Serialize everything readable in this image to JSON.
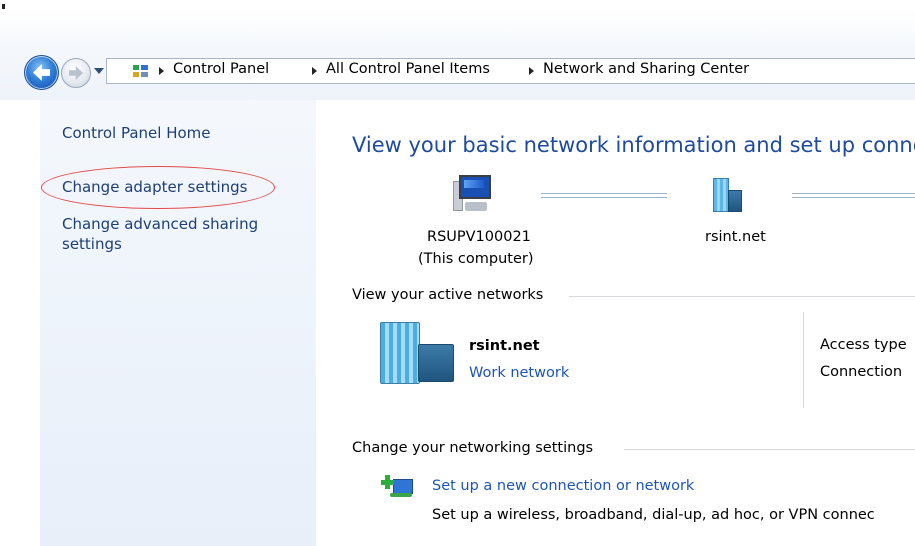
{
  "breadcrumb": [
    "Control Panel",
    "All Control Panel Items",
    "Network and Sharing Center"
  ],
  "left_nav": {
    "home": "Control Panel Home",
    "adapter": "Change adapter settings",
    "advanced_line1": "Change advanced sharing",
    "advanced_line2": "settings"
  },
  "main": {
    "title": "View your basic network information and set up conne",
    "map": {
      "computer_name": "RSUPV100021",
      "computer_note": "(This computer)",
      "network_name": "rsint.net"
    },
    "active_networks": {
      "heading": "View your active networks",
      "name": "rsint.net",
      "type": "Work network",
      "access_label": "Access type",
      "connections_label": "Connection"
    },
    "change_settings": {
      "heading": "Change your networking settings",
      "setup_link": "Set up a new connection or network",
      "setup_desc": "Set up a wireless, broadband, dial-up, ad hoc, or VPN connec"
    }
  },
  "colors": {
    "link": "#1e55b5",
    "title": "#1e4aa0",
    "highlight_oval": "#e24b4b",
    "nav_pane": "#eef3fa"
  }
}
